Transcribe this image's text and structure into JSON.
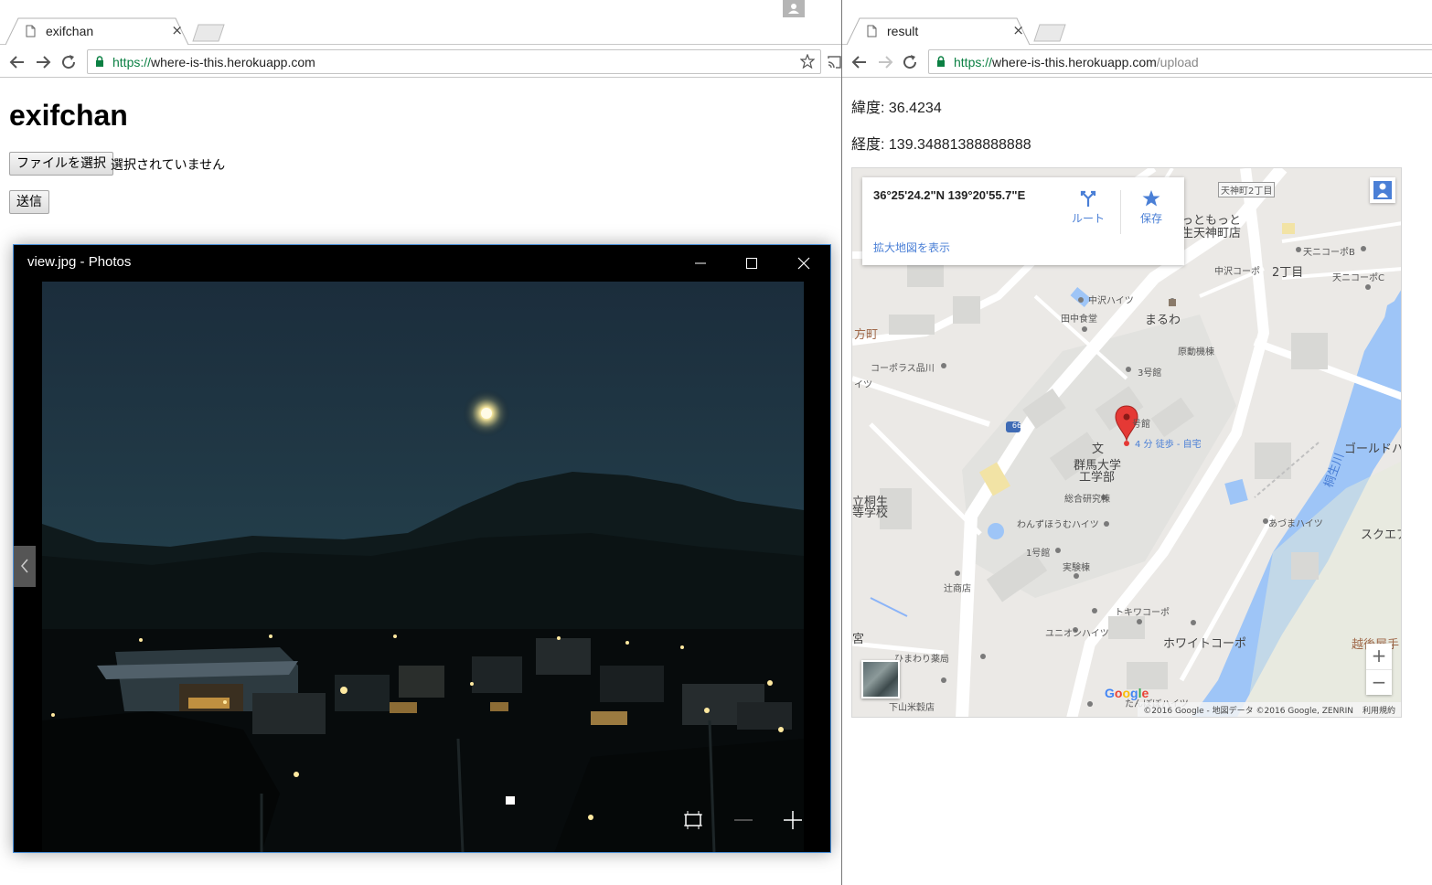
{
  "left_browser": {
    "tab": {
      "title": "exifchan"
    },
    "url": {
      "scheme": "https://",
      "host": "where-is-this.herokuapp.com",
      "path": ""
    },
    "page": {
      "heading": "exifchan",
      "file_button": "ファイルを選択",
      "file_status": "選択されていません",
      "submit_button": "送信"
    }
  },
  "photos_window": {
    "title": "view.jpg - Photos"
  },
  "right_browser": {
    "tab": {
      "title": "result"
    },
    "url": {
      "scheme": "https://",
      "host": "where-is-this.herokuapp.com",
      "path": "/upload"
    },
    "page": {
      "latitude": "緯度: 36.4234",
      "longitude": "経度: 139.34881388888888"
    }
  },
  "map": {
    "info_card": {
      "coords": "36°25'24.2\"N 139°20'55.7\"E",
      "route_label": "ルート",
      "save_label": "保存",
      "larger_map_link": "拡大地図を表示"
    },
    "labels": {
      "tenjin_2": "天神町2丁目",
      "motto": "っともっと",
      "tenjin_store": "生天神町店",
      "kami": "方町",
      "tenjin_b": "天ニコーポB",
      "nakazawa_corp": "中沢コーポ",
      "chome2": "2丁目",
      "tenjin_c": "天ニコーポC",
      "nakazawa_heights": "中沢ハイツ",
      "tanaka_shokudo": "田中食堂",
      "maruwa": "まるわ",
      "genryo": "原動機棟",
      "co_op": "コーポラス品川",
      "building3": "3号館",
      "gou": "号館",
      "walk": "4 分 徒歩 - 自宅",
      "univ1": "群馬大学",
      "univ2": "工学部",
      "gold": "ゴールドハ",
      "kiryu1": "立桐生",
      "kiryu2": "等学校",
      "souken": "総合研究棟",
      "wanzu": "わんずほうむハイツ",
      "river": "桐生川",
      "azuma": "あづまハイツ",
      "square": "スクエア",
      "building1": "1号館",
      "jikken": "実験棟",
      "tsuji": "辻商店",
      "tokiwa": "トキワコーポ",
      "white": "ホワイトコーポ",
      "union": "ユニオンハイツ",
      "echigo": "越後屋手",
      "miya": "宮",
      "himawari": "ひまわり薬局",
      "shimoyama": "下山米穀店",
      "tanbo": "たんぼぼハイツ",
      "route_num": "66",
      "bun": "文",
      "itsu": "イツ"
    },
    "attribution": "©2016 Google - 地図データ ©2016 Google, ZENRIN",
    "terms": "利用規約",
    "logo": "Google"
  }
}
